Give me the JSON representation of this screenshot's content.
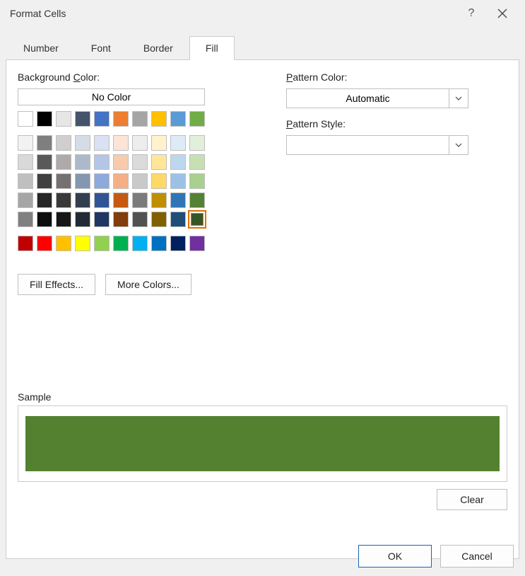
{
  "dialog": {
    "title": "Format Cells",
    "help": "?",
    "tabs": [
      "Number",
      "Font",
      "Border",
      "Fill"
    ],
    "active_tab": "Fill"
  },
  "fill": {
    "bg_color_prefix": "Background ",
    "bg_color_u": "C",
    "bg_color_suffix": "olor:",
    "no_color": "No Color",
    "fill_effects_prefix": "Fi",
    "fill_effects_u": "l",
    "fill_effects_suffix": "l Effects...",
    "more_colors_u": "M",
    "more_colors_suffix": "ore Colors...",
    "pattern_color_u": "P",
    "pattern_color_suffix": "attern Color:",
    "pattern_color_value": "Automatic",
    "pattern_style_u": "P",
    "pattern_style_suffix": "attern Style:",
    "pattern_style_value": "",
    "sample": "Sample",
    "clear_prefix": "Clea",
    "clear_u": "r",
    "selected_color": "#53812f"
  },
  "buttons": {
    "ok": "OK",
    "cancel": "Cancel"
  },
  "theme_row1": [
    "#ffffff",
    "#000000",
    "#e7e6e6",
    "#44546a",
    "#4472c4",
    "#ed7d31",
    "#a5a5a5",
    "#ffc000",
    "#5b9bd5",
    "#70ad47"
  ],
  "theme_grid": [
    "#f2f2f2",
    "#7f7f7f",
    "#d0cece",
    "#d6dce5",
    "#d9e1f2",
    "#fce4d6",
    "#ededed",
    "#fff2cc",
    "#ddebf7",
    "#e2efda",
    "#d9d9d9",
    "#595959",
    "#aeaaaa",
    "#acb9ca",
    "#b4c6e7",
    "#f8cbad",
    "#dbdbdb",
    "#ffe699",
    "#bdd7ee",
    "#c6e0b4",
    "#bfbfbf",
    "#404040",
    "#757171",
    "#8497b0",
    "#8ea9db",
    "#f4b084",
    "#c9c9c9",
    "#ffd966",
    "#9bc2e6",
    "#a9d08e",
    "#a6a6a6",
    "#262626",
    "#3a3838",
    "#333f4f",
    "#305496",
    "#c65911",
    "#7b7b7b",
    "#bf8f00",
    "#2f75b5",
    "#548235",
    "#808080",
    "#0d0d0d",
    "#171717",
    "#222b35",
    "#203764",
    "#833c0c",
    "#525252",
    "#806000",
    "#1f4e78",
    "#375623"
  ],
  "standard_colors": [
    "#c00000",
    "#ff0000",
    "#ffc000",
    "#ffff00",
    "#92d050",
    "#00b050",
    "#00b0f0",
    "#0070c0",
    "#002060",
    "#7030a0"
  ]
}
